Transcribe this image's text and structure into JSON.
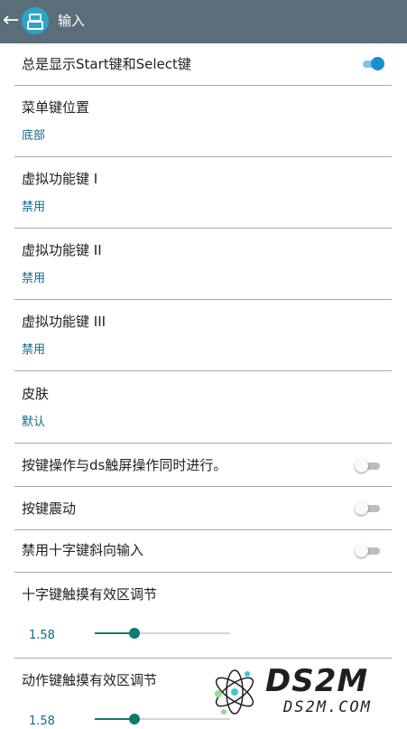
{
  "appbar": {
    "back_icon": "arrow-left-icon",
    "logo_icon": "app-logo-icon",
    "title": "输入"
  },
  "settings": {
    "always_show_start_select": {
      "label": "总是显示Start键和Select键",
      "enabled": true
    },
    "menu_key_position": {
      "label": "菜单键位置",
      "value": "底部"
    },
    "virtual_key_1": {
      "label": "虚拟功能键 I",
      "value": "禁用"
    },
    "virtual_key_2": {
      "label": "虚拟功能键 II",
      "value": "禁用"
    },
    "virtual_key_3": {
      "label": "虚拟功能键 III",
      "value": "禁用"
    },
    "skin": {
      "label": "皮肤",
      "value": "默认"
    },
    "simultaneous_touch": {
      "label": "按键操作与ds触屏操作同时进行。",
      "enabled": false
    },
    "key_vibration": {
      "label": "按键震动",
      "enabled": false
    },
    "disable_dpad_diagonal": {
      "label": "禁用十字键斜向输入",
      "enabled": false
    },
    "dpad_touch_area": {
      "label": "十字键触摸有效区调节",
      "value": "1.58",
      "level": 0.29
    },
    "action_touch_area": {
      "label": "动作键触摸有效区调节",
      "value": "1.58",
      "level": 0.29
    }
  },
  "watermark": {
    "brand": "DS2M",
    "site": "DS2M.COM",
    "icon": "atom-logo-icon"
  },
  "colors": {
    "appbar": "#5a6e79",
    "accent": "#0f7a73",
    "link": "#0e6a8a",
    "switch_on": "#1a8fd0"
  }
}
